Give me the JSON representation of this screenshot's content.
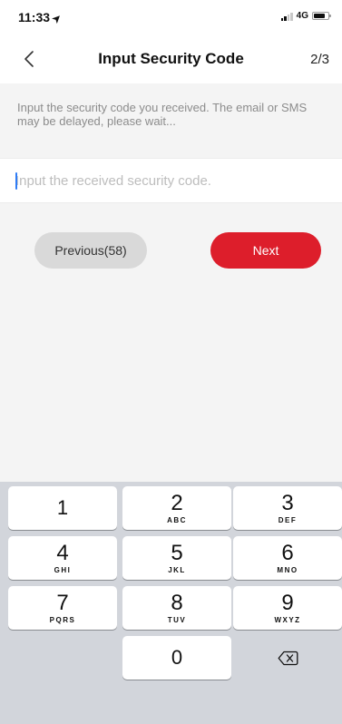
{
  "status_bar": {
    "time": "11:33",
    "network": "4G",
    "battery_level": 0.8
  },
  "nav": {
    "title": "Input Security Code",
    "step": "2/3"
  },
  "hint": {
    "text": "Input the security code you received. The email or SMS may be delayed, please wait..."
  },
  "code_input": {
    "value": "",
    "placeholder": "Input the received security code."
  },
  "actions": {
    "previous_label": "Previous(58)",
    "next_label": "Next"
  },
  "colors": {
    "accent": "#dd1e2b",
    "secondary_button": "#d9d9d9",
    "caret": "#2f7cf6"
  },
  "keypad": {
    "keys": [
      {
        "digit": "1",
        "letters": ""
      },
      {
        "digit": "2",
        "letters": "ABC"
      },
      {
        "digit": "3",
        "letters": "DEF"
      },
      {
        "digit": "4",
        "letters": "GHI"
      },
      {
        "digit": "5",
        "letters": "JKL"
      },
      {
        "digit": "6",
        "letters": "MNO"
      },
      {
        "digit": "7",
        "letters": "PQRS"
      },
      {
        "digit": "8",
        "letters": "TUV"
      },
      {
        "digit": "9",
        "letters": "WXYZ"
      },
      {
        "digit": "0",
        "letters": ""
      }
    ],
    "delete_icon": "backspace-icon"
  }
}
